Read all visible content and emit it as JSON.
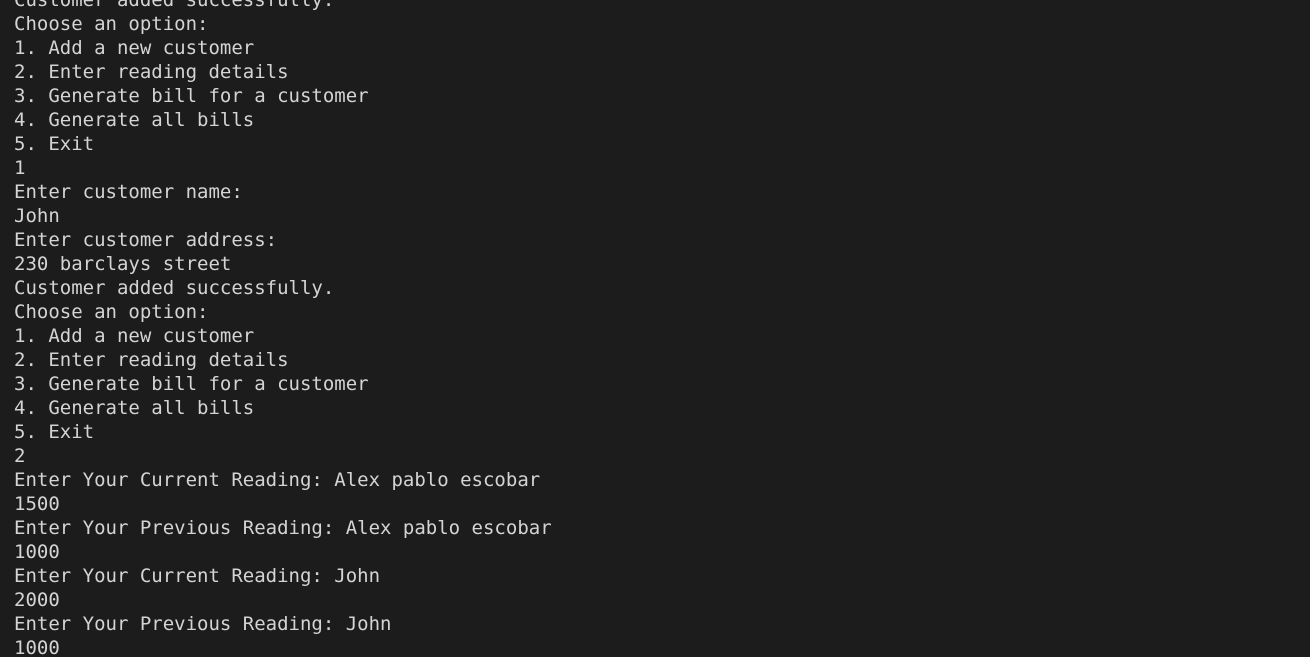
{
  "terminal": {
    "lines": [
      "Customer added successfully.",
      "Choose an option:",
      "1. Add a new customer",
      "2. Enter reading details",
      "3. Generate bill for a customer",
      "4. Generate all bills",
      "5. Exit",
      "1",
      "Enter customer name:",
      "John",
      "Enter customer address:",
      "230 barclays street",
      "Customer added successfully.",
      "Choose an option:",
      "1. Add a new customer",
      "2. Enter reading details",
      "3. Generate bill for a customer",
      "4. Generate all bills",
      "5. Exit",
      "2",
      "Enter Your Current Reading: Alex pablo escobar",
      "1500",
      "Enter Your Previous Reading: Alex pablo escobar",
      "1000",
      "Enter Your Current Reading: John",
      "2000",
      "Enter Your Previous Reading: John",
      "1000"
    ]
  }
}
